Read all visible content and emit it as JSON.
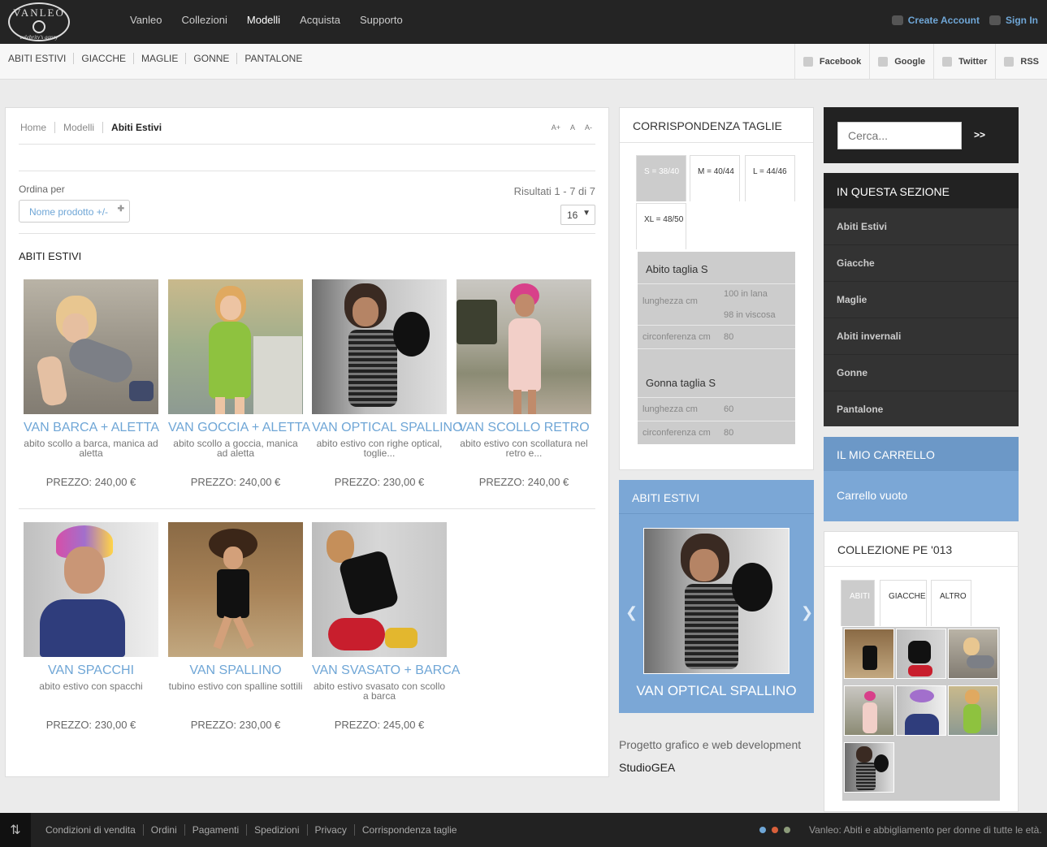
{
  "brand": {
    "logo_text": "VANLEO",
    "logo_sub": "celebrity's ganry"
  },
  "nav": {
    "items": [
      "Vanleo",
      "Collezioni",
      "Modelli",
      "Acquista",
      "Supporto"
    ],
    "active": 2
  },
  "account": {
    "create": "Create Account",
    "signin": "Sign In"
  },
  "subnav": [
    "ABITI ESTIVI",
    "GIACCHE",
    "MAGLIE",
    "GONNE",
    "PANTALONE"
  ],
  "social": [
    "Facebook",
    "Google",
    "Twitter",
    "RSS"
  ],
  "breadcrumb": [
    "Home",
    "Modelli",
    "Abiti Estivi"
  ],
  "fontsize": [
    "A+",
    "A",
    "A-"
  ],
  "sort": {
    "label": "Ordina per",
    "value": "Nome prodotto +/-"
  },
  "results": {
    "text": "Risultati 1 - 7 di 7",
    "perpage": "16"
  },
  "section_title": "ABITI ESTIVI",
  "price_label": "PREZZO:",
  "products": [
    {
      "name": "VAN BARCA + ALETTA",
      "desc": "abito scollo a barca, manica ad aletta",
      "price": "240,00 €"
    },
    {
      "name": "VAN GOCCIA + ALETTA",
      "desc": "abito scollo a goccia, manica ad aletta",
      "price": "240,00 €"
    },
    {
      "name": "VAN OPTICAL SPALLINO",
      "desc": "abito estivo con righe optical, toglie...",
      "price": "230,00 €"
    },
    {
      "name": "VAN SCOLLO RETRO",
      "desc": "abito estivo con scollatura nel retro e...",
      "price": "240,00 €"
    },
    {
      "name": "VAN SPACCHI",
      "desc": "abito estivo con spacchi",
      "price": "230,00 €"
    },
    {
      "name": "VAN SPALLINO",
      "desc": "tubino estivo con spalline sottili",
      "price": "230,00 €"
    },
    {
      "name": "VAN SVASATO + BARCA",
      "desc": "abito estivo svasato con scollo a barca",
      "price": "245,00 €"
    }
  ],
  "sizes": {
    "title": "CORRISPONDENZA TAGLIE",
    "tabs": [
      "S = 38/40",
      "M = 40/44",
      "L = 44/46",
      "XL = 48/50"
    ],
    "abito_title": "Abito taglia S",
    "lunghezza_label": "lunghezza cm",
    "lunghezza_v1": "100 in lana",
    "lunghezza_v2": "98 in viscosa",
    "circ_label": "circonferenza  cm",
    "circ_value": "80",
    "gonna_title": "Gonna taglia S",
    "gonna_lunghezza_label": "lunghezza cm",
    "gonna_lunghezza": "60",
    "gonna_circ_label": "circonferenza  cm",
    "gonna_circ": "80"
  },
  "slider": {
    "title": "ABITI ESTIVI",
    "caption": "VAN OPTICAL SPALLINO"
  },
  "credits": {
    "line1": "Progetto grafico e web development",
    "line2": "StudioGEA"
  },
  "search": {
    "placeholder": "Cerca...",
    "button": ">>"
  },
  "in_section": {
    "title": "IN QUESTA SEZIONE",
    "items": [
      "Abiti Estivi",
      "Giacche",
      "Maglie",
      "Abiti invernali",
      "Gonne",
      "Pantalone"
    ]
  },
  "cart": {
    "title": "IL MIO CARRELLO",
    "empty": "Carrello vuoto"
  },
  "collection": {
    "title": "COLLEZIONE PE '013",
    "tabs": [
      "ABITI",
      "GIACCHE",
      "ALTRO"
    ]
  },
  "footer": {
    "links": [
      "Condizioni di vendita",
      "Ordini",
      "Pagamenti",
      "Spedizioni",
      "Privacy",
      "Corrispondenza taglie"
    ],
    "tagline": "Vanleo: Abiti e abbigliamento per donne di tutte le età."
  },
  "colors": {
    "accent": "#7ba7d6",
    "link": "#6fa6d6",
    "dark": "#222222"
  }
}
